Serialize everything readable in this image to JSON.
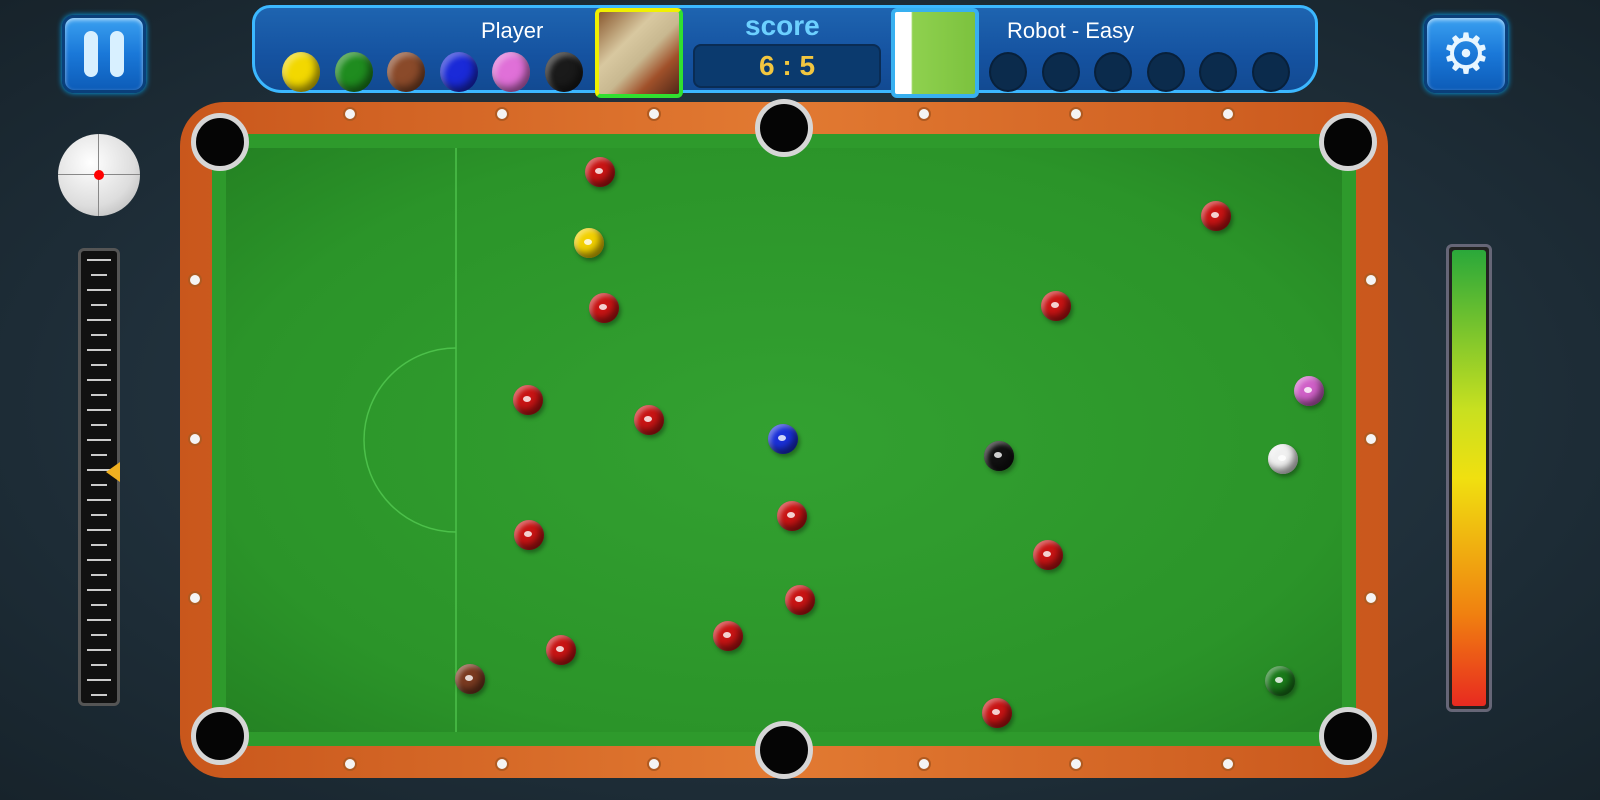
{
  "hud": {
    "player_name": "Player",
    "score_label": "score",
    "score": "6 : 5",
    "opponent_name": "Robot - Easy",
    "player_balls": [
      "#f2d800",
      "#1f8c1f",
      "#8a4a2a",
      "#1a2ad8",
      "#e070d8",
      "#1a1a1a"
    ],
    "opponent_slots": 6
  },
  "controls": {
    "pause": "pause-icon",
    "settings": "gear-icon",
    "spin_selector": "cue-ball-aim",
    "spin_slider_level": 0.49,
    "power_meter_level": 1.0
  },
  "colors": {
    "felt": "#2b9429",
    "rail": "#e27a32",
    "hud": "#1552a0",
    "red": "#c81414",
    "cue": "#f0f0f0"
  },
  "table_balls": [
    "red",
    "yellow",
    "red",
    "red",
    "red",
    "blue",
    "red",
    "red",
    "red",
    "red",
    "red",
    "brown",
    "red",
    "red",
    "black",
    "cue",
    "pink",
    "green",
    "red",
    "red"
  ]
}
